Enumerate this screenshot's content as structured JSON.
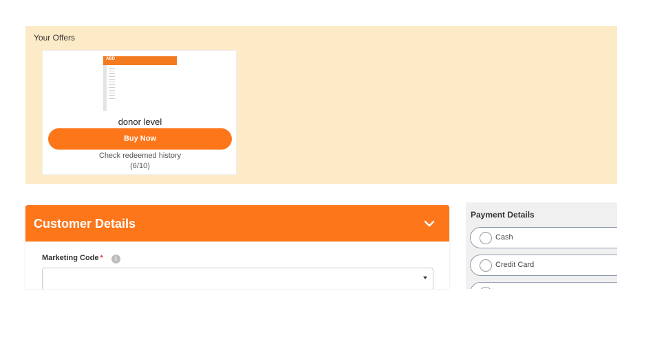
{
  "offers": {
    "title": "Your Offers",
    "items": [
      {
        "name": "donor level",
        "thumbnail_logo": "ABD",
        "buy_label": "Buy Now",
        "redeem_link": "Check redeemed history",
        "redeem_count": "(6/10)"
      }
    ]
  },
  "customer": {
    "title": "Customer Details",
    "marketing_code_label": "Marketing Code",
    "required_mark": "*",
    "info_glyph": "i",
    "marketing_code_value": ""
  },
  "payment": {
    "title": "Payment Details",
    "options": [
      {
        "label": "Cash"
      },
      {
        "label": "Credit Card"
      },
      {
        "label": ""
      }
    ]
  },
  "colors": {
    "accent": "#fd761a",
    "offers_bg": "#fdebc8",
    "payment_bg": "#f0f0f0"
  },
  "icons": {
    "collapse": "chevron-down-icon",
    "info": "info-icon",
    "dropdown": "caret-down-icon"
  }
}
